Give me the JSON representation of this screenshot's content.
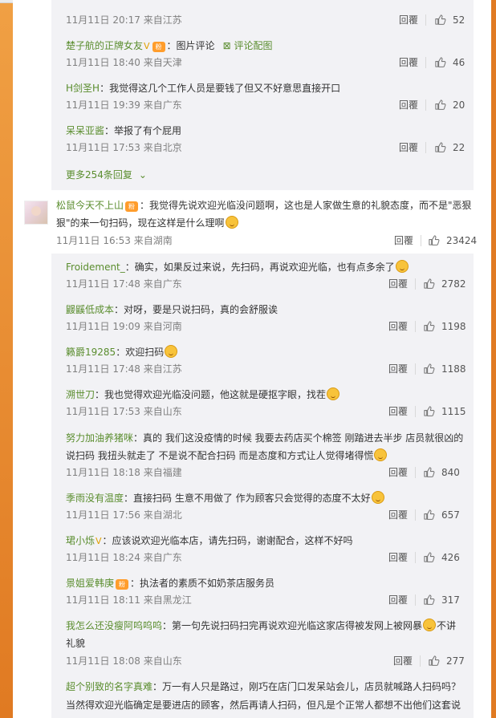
{
  "reply_label": "回覆",
  "more_replies": "更多254条回复",
  "upper_comments": [
    {
      "meta": "11月11日 20:17 来自江苏",
      "likes": "52"
    },
    {
      "user": "楚子航的正牌女友",
      "text": "：图片评论",
      "extra": "评论配图",
      "meta": "11月11日 18:40 来自天津",
      "likes": "46"
    },
    {
      "user": "H剑圣H",
      "text": "：我觉得这几个工作人员是要钱了但又不好意思直接开口",
      "meta": "11月11日 19:39 来自广东",
      "likes": "20"
    },
    {
      "user": "呆呆亚酱",
      "text": "：举报了有个屁用",
      "meta": "11月11日 17:53 来自北京",
      "likes": "22"
    }
  ],
  "main_comment": {
    "user": "松鼠今天不上山",
    "text_1": "：我觉得先说欢迎光临没问题啊，这也是人家做生意的礼貌态度，而不是\"恶狠",
    "text_2": "狠\"的来一句扫码，现在这样是什么理啊",
    "meta": "11月11日 16:53 来自湖南",
    "likes": "23424"
  },
  "replies": [
    {
      "user": "Froidement_",
      "text": "：确实，如果反过来说，先扫码，再说欢迎光临，也有点多余了",
      "meta": "11月11日 17:48 来自广东",
      "likes": "2782"
    },
    {
      "user": "鼹鼷低成本",
      "text": "：对呀，要是只说扫码，真的会舒服诶",
      "meta": "11月11日 19:09 来自河南",
      "likes": "1198"
    },
    {
      "user": "籁爵19285",
      "text": "：欢迎扫码",
      "meta": "11月11日 17:48 来自江苏",
      "likes": "1188"
    },
    {
      "user": "溯世刀",
      "text": "：我也觉得欢迎光临没问题，他这就是硬抠字眼，找茬",
      "meta": "11月11日 17:53 来自山东",
      "likes": "1115"
    },
    {
      "user": "努力加油养猪咪",
      "text_1": "：真的 我们这没疫情的时候 我要去药店买个棉签 刚踏进去半步 店员就很凶的",
      "text_2": "说扫码 我扭头就走了 不是说不配合扫码 而是态度和方式让人觉得堵得慌",
      "meta": "11月11日 18:18 来自福建",
      "likes": "840"
    },
    {
      "user": "季雨没有温度",
      "text": "：直接扫码 生意不用做了 作为顾客只会觉得的态度不太好",
      "meta": "11月11日 17:56 来自湖北",
      "likes": "657"
    },
    {
      "user": "珺小烁",
      "text": "：应该说欢迎光临本店，请先扫码，谢谢配合，这样不好吗",
      "meta": "11月11日 18:24 来自广东",
      "likes": "426"
    },
    {
      "user": "景姐爱韩庚",
      "text": "：执法者的素质不如奶茶店服务员",
      "meta": "11月11日 18:11 来自黑龙江",
      "likes": "317"
    },
    {
      "user": "我怎么还没瘦阿呜呜呜",
      "text_1": "：第一句先说扫码扫完再说欢迎光临这家店得被发网上被网暴",
      "text_1b": "不讲",
      "text_2": "礼貌",
      "meta": "11月11日 18:08 来自山东",
      "likes": "277"
    },
    {
      "user": "超个别致的名字真难",
      "text_1": "：万一有人只是路过，刚巧在店门口发呆站会儿，店员就喊路人扫码吗？",
      "text_2": "当然得欢迎光临确定是要进店的顾客，然后再请人扫码，但凡是个正常人都想不出他们这套说"
    }
  ]
}
